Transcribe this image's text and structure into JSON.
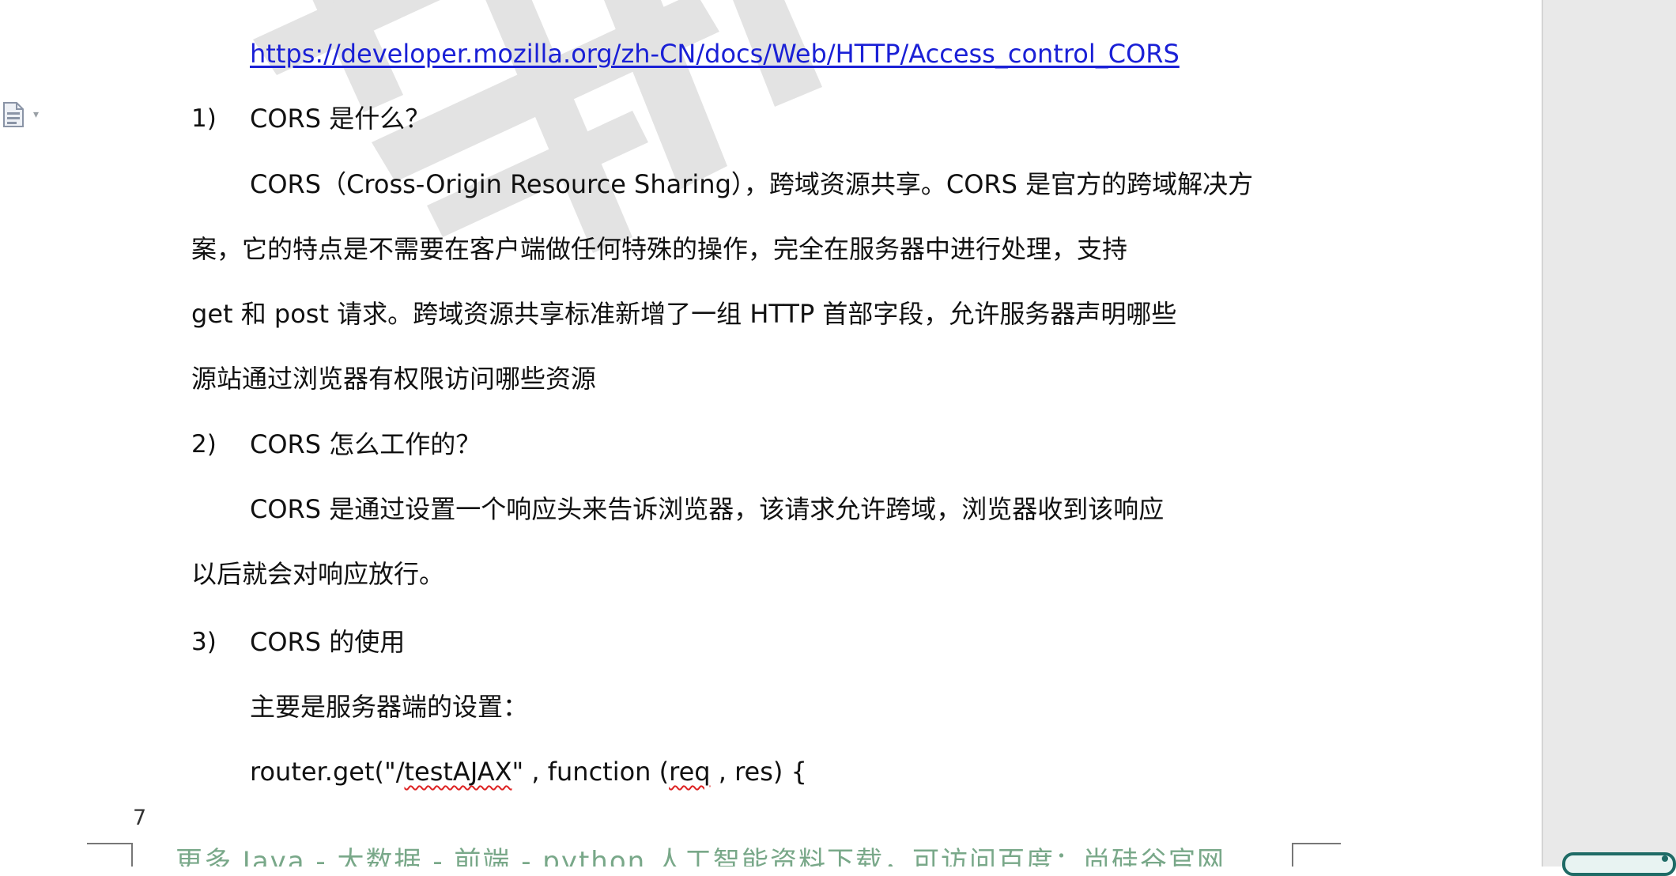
{
  "link": "https://developer.mozilla.org/zh-CN/docs/Web/HTTP/Access_control_CORS",
  "sections": [
    {
      "number": "1)",
      "heading": "CORS 是什么？",
      "paragraph": [
        "CORS（Cross-Origin Resource Sharing），跨域资源共享。CORS 是官方的跨域解决方",
        "案，它的特点是不需要在客户端做任何特殊的操作，完全在服务器中进行处理，支持",
        "get 和 post 请求。跨域资源共享标准新增了一组 HTTP  首部字段，允许服务器声明哪些",
        "源站通过浏览器有权限访问哪些资源"
      ]
    },
    {
      "number": "2)",
      "heading": "CORS 怎么工作的？",
      "paragraph": [
        "CORS 是通过设置一个响应头来告诉浏览器，该请求允许跨域，浏览器收到该响应",
        "以后就会对响应放行。"
      ]
    },
    {
      "number": "3)",
      "heading": "CORS 的使用",
      "paragraph": [
        "主要是服务器端的设置："
      ]
    }
  ],
  "code": {
    "part1": "router.get(\"/",
    "part2": "testAJAX",
    "part3": "\" , function (",
    "part4": "req",
    "part5": " , res) {"
  },
  "page_number": "7",
  "footer_text": "更多 Java - 大数据 - 前端 - python 人工智能资料下载，可访问百度：尚硅谷官网",
  "icons": [
    "document-icon",
    "dropdown-caret-icon"
  ],
  "colors": {
    "link": "#1a20d6",
    "watermark": "#e0e0e0",
    "footer": "#79a889",
    "gutter": "#e9e9e9",
    "tray_accent": "#1f6b66"
  }
}
